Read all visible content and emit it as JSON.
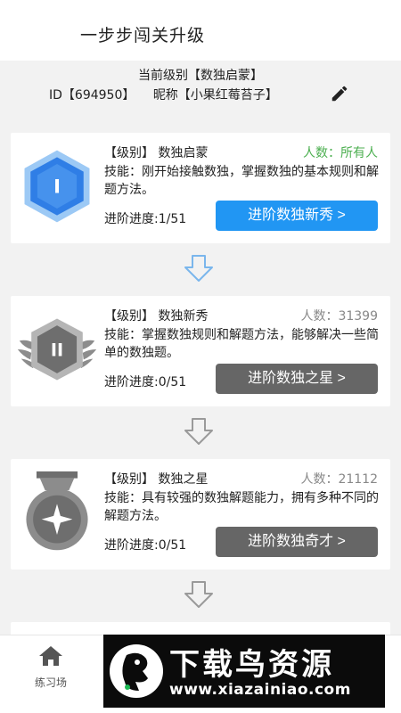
{
  "header": {
    "title": "一步步闯关升级"
  },
  "profile": {
    "current_level": "当前级别【数独启蒙】",
    "id": "ID【694950】",
    "nickname": "昵称【小果红莓苔子】"
  },
  "levels": [
    {
      "title": "【级别】 数独启蒙",
      "count": "人数：所有人",
      "skill": "技能：刚开始接触数独，掌握数独的基本规则和解题方法。",
      "progress": "进阶进度:1/51",
      "button": "进阶数独新秀 >",
      "badge_numeral": "I",
      "button_color": "#2196f3"
    },
    {
      "title": "【级别】 数独新秀",
      "count": "人数：31399",
      "skill": "技能：掌握数独规则和解题方法，能够解决一些简单的数独题。",
      "progress": "进阶进度:0/51",
      "button": "进阶数独之星 >",
      "badge_numeral": "II",
      "button_color": "#666666"
    },
    {
      "title": "【级别】 数独之星",
      "count": "人数：21112",
      "skill": "技能：具有较强的数独解题能力，拥有多种不同的解题方法。",
      "progress": "进阶进度:0/51",
      "button": "进阶数独奇才 >",
      "badge_numeral": "",
      "button_color": "#666666"
    }
  ],
  "tabbar": {
    "items": [
      {
        "label": "练习场",
        "icon": "home-icon"
      }
    ]
  },
  "watermark": {
    "text": "下载鸟资源",
    "url": "www.xiazainiao.com"
  },
  "colors": {
    "accent": "#2196f3",
    "green": "#4caf50",
    "gray_button": "#666666"
  }
}
